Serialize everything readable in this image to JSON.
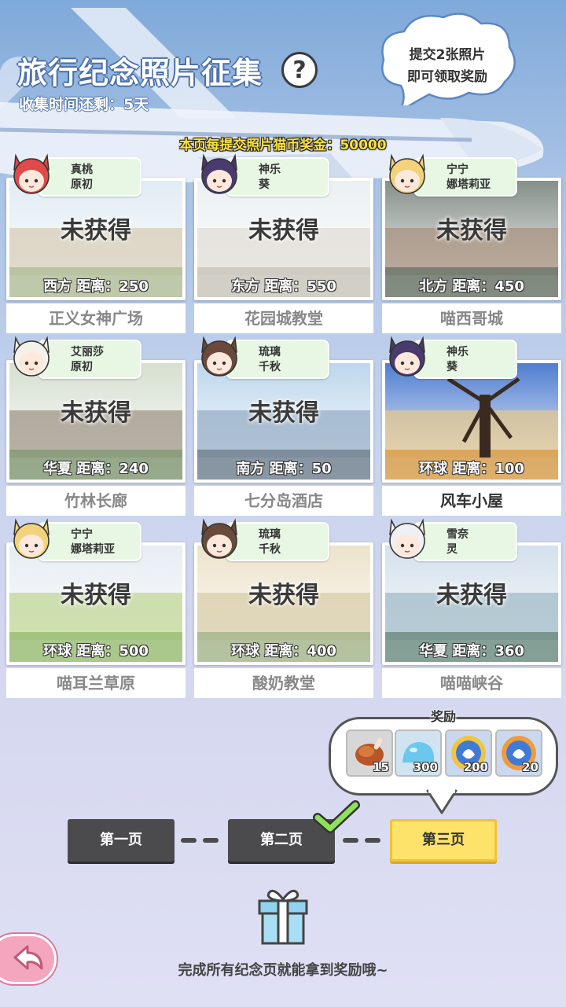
{
  "header": {
    "title": "旅行纪念照片征集",
    "help_icon": "?",
    "time_left": "收集时间还剩：5天",
    "bubble_line1": "提交2张照片",
    "bubble_line2": "即可领取奖励",
    "bonus": "本页每提交照片猫币奖金：50000"
  },
  "cards": [
    {
      "char1": "真桃",
      "char2": "原初",
      "status": "未获得",
      "dist": "西方  距离：250",
      "place": "正义女神广场",
      "done": false,
      "hair": "#e04a4a"
    },
    {
      "char1": "神乐",
      "char2": "葵",
      "status": "未获得",
      "dist": "东方  距离：550",
      "place": "花园城教堂",
      "done": false,
      "hair": "#4a3a6e"
    },
    {
      "char1": "宁宁",
      "char2": "娜塔莉亚",
      "status": "未获得",
      "dist": "北方  距离：450",
      "place": "喵西哥城",
      "done": false,
      "hair": "#f2d27a"
    },
    {
      "char1": "艾丽莎",
      "char2": "原初",
      "status": "未获得",
      "dist": "华夏  距离：240",
      "place": "竹林长廊",
      "done": false,
      "hair": "#f4f0ea"
    },
    {
      "char1": "琉璃",
      "char2": "千秋",
      "status": "未获得",
      "dist": "南方  距离：50",
      "place": "七分岛酒店",
      "done": false,
      "hair": "#6a4a3a"
    },
    {
      "char1": "神乐",
      "char2": "葵",
      "status": "",
      "dist": "环球  距离：100",
      "place": "风车小屋",
      "done": true,
      "hair": "#4a3a6e"
    },
    {
      "char1": "宁宁",
      "char2": "娜塔莉亚",
      "status": "未获得",
      "dist": "环球  距离：500",
      "place": "喵耳兰草原",
      "done": false,
      "hair": "#f2d27a"
    },
    {
      "char1": "琉璃",
      "char2": "千秋",
      "status": "未获得",
      "dist": "环球  距离：400",
      "place": "酸奶教堂",
      "done": false,
      "hair": "#6a4a3a"
    },
    {
      "char1": "雪奈",
      "char2": "灵",
      "status": "未获得",
      "dist": "华夏  距离：360",
      "place": "喵喵峡谷",
      "done": false,
      "hair": "#f0f0f4"
    }
  ],
  "rewards": {
    "title": "奖励",
    "items": [
      {
        "icon": "meat-icon",
        "count": "15"
      },
      {
        "icon": "blue-slime-icon",
        "count": "300"
      },
      {
        "icon": "gold-badge-icon",
        "count": "200"
      },
      {
        "icon": "orange-badge-icon",
        "count": "20"
      }
    ]
  },
  "pages": [
    "第一页",
    "第二页",
    "第三页"
  ],
  "footer": "完成所有纪念页就能拿到奖励哦~",
  "colors": {
    "accent_yellow": "#fde36a",
    "tag_green": "#e7f7e4",
    "button_dark": "#4b4b4e"
  }
}
